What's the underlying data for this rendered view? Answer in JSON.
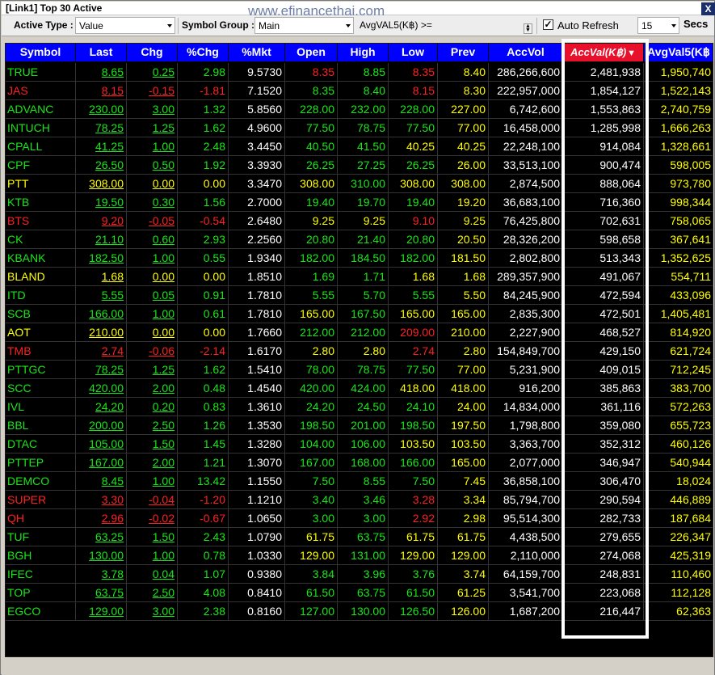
{
  "window": {
    "title": "[Link1] Top 30 Active",
    "watermark": "www.efinancethai.com",
    "close": "X"
  },
  "toolbar": {
    "active_type_label": "Active Type :",
    "active_type_value": "Value",
    "symbol_group_label": "Symbol Group :",
    "symbol_group_value": "Main",
    "condition_label": "AvgVAL5(K฿) >=",
    "condition_value": "",
    "auto_refresh_checked": true,
    "auto_refresh_label": "Auto Refresh",
    "interval_value": "15",
    "interval_unit": "Secs"
  },
  "table": {
    "columns": [
      "Symbol",
      "Last",
      "Chg",
      "%Chg",
      "%Mkt",
      "Open",
      "High",
      "Low",
      "Prev",
      "AccVol",
      "AccVal(K฿)",
      "AvgVal5(K฿"
    ],
    "sorted_column": "AccVal(K฿)",
    "rows": [
      {
        "s": "TRUE",
        "last": "8.65",
        "chg": "0.25",
        "pct": "2.98",
        "mkt": "9.5730",
        "open": "8.35",
        "high": "8.85",
        "low": "8.35",
        "prev": "8.40",
        "vol": "286,266,600",
        "val": "2,481,938",
        "avg": "1,950,740",
        "c": "g",
        "oc": "r",
        "hc": "g",
        "lc": "r"
      },
      {
        "s": "JAS",
        "last": "8.15",
        "chg": "-0.15",
        "pct": "-1.81",
        "mkt": "7.1520",
        "open": "8.35",
        "high": "8.40",
        "low": "8.15",
        "prev": "8.30",
        "vol": "222,957,000",
        "val": "1,854,127",
        "avg": "1,522,143",
        "c": "r",
        "oc": "g",
        "hc": "g",
        "lc": "r"
      },
      {
        "s": "ADVANC",
        "last": "230.00",
        "chg": "3.00",
        "pct": "1.32",
        "mkt": "5.8560",
        "open": "228.00",
        "high": "232.00",
        "low": "228.00",
        "prev": "227.00",
        "vol": "6,742,600",
        "val": "1,553,863",
        "avg": "2,740,759",
        "c": "g",
        "oc": "g",
        "hc": "g",
        "lc": "g"
      },
      {
        "s": "INTUCH",
        "last": "78.25",
        "chg": "1.25",
        "pct": "1.62",
        "mkt": "4.9600",
        "open": "77.50",
        "high": "78.75",
        "low": "77.50",
        "prev": "77.00",
        "vol": "16,458,000",
        "val": "1,285,998",
        "avg": "1,666,263",
        "c": "g",
        "oc": "g",
        "hc": "g",
        "lc": "g"
      },
      {
        "s": "CPALL",
        "last": "41.25",
        "chg": "1.00",
        "pct": "2.48",
        "mkt": "3.4450",
        "open": "40.50",
        "high": "41.50",
        "low": "40.25",
        "prev": "40.25",
        "vol": "22,248,100",
        "val": "914,084",
        "avg": "1,328,661",
        "c": "g",
        "oc": "g",
        "hc": "g",
        "lc": "y"
      },
      {
        "s": "CPF",
        "last": "26.50",
        "chg": "0.50",
        "pct": "1.92",
        "mkt": "3.3930",
        "open": "26.25",
        "high": "27.25",
        "low": "26.25",
        "prev": "26.00",
        "vol": "33,513,100",
        "val": "900,474",
        "avg": "598,005",
        "c": "g",
        "oc": "g",
        "hc": "g",
        "lc": "g"
      },
      {
        "s": "PTT",
        "last": "308.00",
        "chg": "0.00",
        "pct": "0.00",
        "mkt": "3.3470",
        "open": "308.00",
        "high": "310.00",
        "low": "308.00",
        "prev": "308.00",
        "vol": "2,874,500",
        "val": "888,064",
        "avg": "973,780",
        "c": "y",
        "oc": "y",
        "hc": "g",
        "lc": "y"
      },
      {
        "s": "KTB",
        "last": "19.50",
        "chg": "0.30",
        "pct": "1.56",
        "mkt": "2.7000",
        "open": "19.40",
        "high": "19.70",
        "low": "19.40",
        "prev": "19.20",
        "vol": "36,683,100",
        "val": "716,360",
        "avg": "998,344",
        "c": "g",
        "oc": "g",
        "hc": "g",
        "lc": "g"
      },
      {
        "s": "BTS",
        "last": "9.20",
        "chg": "-0.05",
        "pct": "-0.54",
        "mkt": "2.6480",
        "open": "9.25",
        "high": "9.25",
        "low": "9.10",
        "prev": "9.25",
        "vol": "76,425,800",
        "val": "702,631",
        "avg": "758,065",
        "c": "r",
        "oc": "y",
        "hc": "y",
        "lc": "r"
      },
      {
        "s": "CK",
        "last": "21.10",
        "chg": "0.60",
        "pct": "2.93",
        "mkt": "2.2560",
        "open": "20.80",
        "high": "21.40",
        "low": "20.80",
        "prev": "20.50",
        "vol": "28,326,200",
        "val": "598,658",
        "avg": "367,641",
        "c": "g",
        "oc": "g",
        "hc": "g",
        "lc": "g"
      },
      {
        "s": "KBANK",
        "last": "182.50",
        "chg": "1.00",
        "pct": "0.55",
        "mkt": "1.9340",
        "open": "182.00",
        "high": "184.50",
        "low": "182.00",
        "prev": "181.50",
        "vol": "2,802,800",
        "val": "513,343",
        "avg": "1,352,625",
        "c": "g",
        "oc": "g",
        "hc": "g",
        "lc": "g"
      },
      {
        "s": "BLAND",
        "last": "1.68",
        "chg": "0.00",
        "pct": "0.00",
        "mkt": "1.8510",
        "open": "1.69",
        "high": "1.71",
        "low": "1.68",
        "prev": "1.68",
        "vol": "289,357,900",
        "val": "491,067",
        "avg": "554,711",
        "c": "y",
        "oc": "g",
        "hc": "g",
        "lc": "y"
      },
      {
        "s": "ITD",
        "last": "5.55",
        "chg": "0.05",
        "pct": "0.91",
        "mkt": "1.7810",
        "open": "5.55",
        "high": "5.70",
        "low": "5.55",
        "prev": "5.50",
        "vol": "84,245,900",
        "val": "472,594",
        "avg": "433,096",
        "c": "g",
        "oc": "g",
        "hc": "g",
        "lc": "g"
      },
      {
        "s": "SCB",
        "last": "166.00",
        "chg": "1.00",
        "pct": "0.61",
        "mkt": "1.7810",
        "open": "165.00",
        "high": "167.50",
        "low": "165.00",
        "prev": "165.00",
        "vol": "2,835,300",
        "val": "472,501",
        "avg": "1,405,481",
        "c": "g",
        "oc": "y",
        "hc": "g",
        "lc": "y"
      },
      {
        "s": "AOT",
        "last": "210.00",
        "chg": "0.00",
        "pct": "0.00",
        "mkt": "1.7660",
        "open": "212.00",
        "high": "212.00",
        "low": "209.00",
        "prev": "210.00",
        "vol": "2,227,900",
        "val": "468,527",
        "avg": "814,920",
        "c": "y",
        "oc": "g",
        "hc": "g",
        "lc": "r"
      },
      {
        "s": "TMB",
        "last": "2.74",
        "chg": "-0.06",
        "pct": "-2.14",
        "mkt": "1.6170",
        "open": "2.80",
        "high": "2.80",
        "low": "2.74",
        "prev": "2.80",
        "vol": "154,849,700",
        "val": "429,150",
        "avg": "621,724",
        "c": "r",
        "oc": "y",
        "hc": "y",
        "lc": "r"
      },
      {
        "s": "PTTGC",
        "last": "78.25",
        "chg": "1.25",
        "pct": "1.62",
        "mkt": "1.5410",
        "open": "78.00",
        "high": "78.75",
        "low": "77.50",
        "prev": "77.00",
        "vol": "5,231,900",
        "val": "409,015",
        "avg": "712,245",
        "c": "g",
        "oc": "g",
        "hc": "g",
        "lc": "g"
      },
      {
        "s": "SCC",
        "last": "420.00",
        "chg": "2.00",
        "pct": "0.48",
        "mkt": "1.4540",
        "open": "420.00",
        "high": "424.00",
        "low": "418.00",
        "prev": "418.00",
        "vol": "916,200",
        "val": "385,863",
        "avg": "383,700",
        "c": "g",
        "oc": "g",
        "hc": "g",
        "lc": "y"
      },
      {
        "s": "IVL",
        "last": "24.20",
        "chg": "0.20",
        "pct": "0.83",
        "mkt": "1.3610",
        "open": "24.20",
        "high": "24.50",
        "low": "24.10",
        "prev": "24.00",
        "vol": "14,834,000",
        "val": "361,116",
        "avg": "572,263",
        "c": "g",
        "oc": "g",
        "hc": "g",
        "lc": "g"
      },
      {
        "s": "BBL",
        "last": "200.00",
        "chg": "2.50",
        "pct": "1.26",
        "mkt": "1.3530",
        "open": "198.50",
        "high": "201.00",
        "low": "198.50",
        "prev": "197.50",
        "vol": "1,798,800",
        "val": "359,080",
        "avg": "655,723",
        "c": "g",
        "oc": "g",
        "hc": "g",
        "lc": "g"
      },
      {
        "s": "DTAC",
        "last": "105.00",
        "chg": "1.50",
        "pct": "1.45",
        "mkt": "1.3280",
        "open": "104.00",
        "high": "106.00",
        "low": "103.50",
        "prev": "103.50",
        "vol": "3,363,700",
        "val": "352,312",
        "avg": "460,126",
        "c": "g",
        "oc": "g",
        "hc": "g",
        "lc": "y"
      },
      {
        "s": "PTTEP",
        "last": "167.00",
        "chg": "2.00",
        "pct": "1.21",
        "mkt": "1.3070",
        "open": "167.00",
        "high": "168.00",
        "low": "166.00",
        "prev": "165.00",
        "vol": "2,077,000",
        "val": "346,947",
        "avg": "540,944",
        "c": "g",
        "oc": "g",
        "hc": "g",
        "lc": "g"
      },
      {
        "s": "DEMCO",
        "last": "8.45",
        "chg": "1.00",
        "pct": "13.42",
        "mkt": "1.1550",
        "open": "7.50",
        "high": "8.55",
        "low": "7.50",
        "prev": "7.45",
        "vol": "36,858,100",
        "val": "306,470",
        "avg": "18,024",
        "c": "g",
        "oc": "g",
        "hc": "g",
        "lc": "g"
      },
      {
        "s": "SUPER",
        "last": "3.30",
        "chg": "-0.04",
        "pct": "-1.20",
        "mkt": "1.1210",
        "open": "3.40",
        "high": "3.46",
        "low": "3.28",
        "prev": "3.34",
        "vol": "85,794,700",
        "val": "290,594",
        "avg": "446,889",
        "c": "r",
        "oc": "g",
        "hc": "g",
        "lc": "r"
      },
      {
        "s": "QH",
        "last": "2.96",
        "chg": "-0.02",
        "pct": "-0.67",
        "mkt": "1.0650",
        "open": "3.00",
        "high": "3.00",
        "low": "2.92",
        "prev": "2.98",
        "vol": "95,514,300",
        "val": "282,733",
        "avg": "187,684",
        "c": "r",
        "oc": "g",
        "hc": "g",
        "lc": "r"
      },
      {
        "s": "TUF",
        "last": "63.25",
        "chg": "1.50",
        "pct": "2.43",
        "mkt": "1.0790",
        "open": "61.75",
        "high": "63.75",
        "low": "61.75",
        "prev": "61.75",
        "vol": "4,438,500",
        "val": "279,655",
        "avg": "226,347",
        "c": "g",
        "oc": "y",
        "hc": "g",
        "lc": "y"
      },
      {
        "s": "BGH",
        "last": "130.00",
        "chg": "1.00",
        "pct": "0.78",
        "mkt": "1.0330",
        "open": "129.00",
        "high": "131.00",
        "low": "129.00",
        "prev": "129.00",
        "vol": "2,110,000",
        "val": "274,068",
        "avg": "425,319",
        "c": "g",
        "oc": "y",
        "hc": "g",
        "lc": "y"
      },
      {
        "s": "IFEC",
        "last": "3.78",
        "chg": "0.04",
        "pct": "1.07",
        "mkt": "0.9380",
        "open": "3.84",
        "high": "3.96",
        "low": "3.76",
        "prev": "3.74",
        "vol": "64,159,700",
        "val": "248,831",
        "avg": "110,460",
        "c": "g",
        "oc": "g",
        "hc": "g",
        "lc": "g"
      },
      {
        "s": "TOP",
        "last": "63.75",
        "chg": "2.50",
        "pct": "4.08",
        "mkt": "0.8410",
        "open": "61.50",
        "high": "63.75",
        "low": "61.50",
        "prev": "61.25",
        "vol": "3,541,700",
        "val": "223,068",
        "avg": "112,128",
        "c": "g",
        "oc": "g",
        "hc": "g",
        "lc": "g"
      },
      {
        "s": "EGCO",
        "last": "129.00",
        "chg": "3.00",
        "pct": "2.38",
        "mkt": "0.8160",
        "open": "127.00",
        "high": "130.00",
        "low": "126.50",
        "prev": "126.00",
        "vol": "1,687,200",
        "val": "216,447",
        "avg": "62,363",
        "c": "g",
        "oc": "g",
        "hc": "g",
        "lc": "g"
      }
    ]
  }
}
